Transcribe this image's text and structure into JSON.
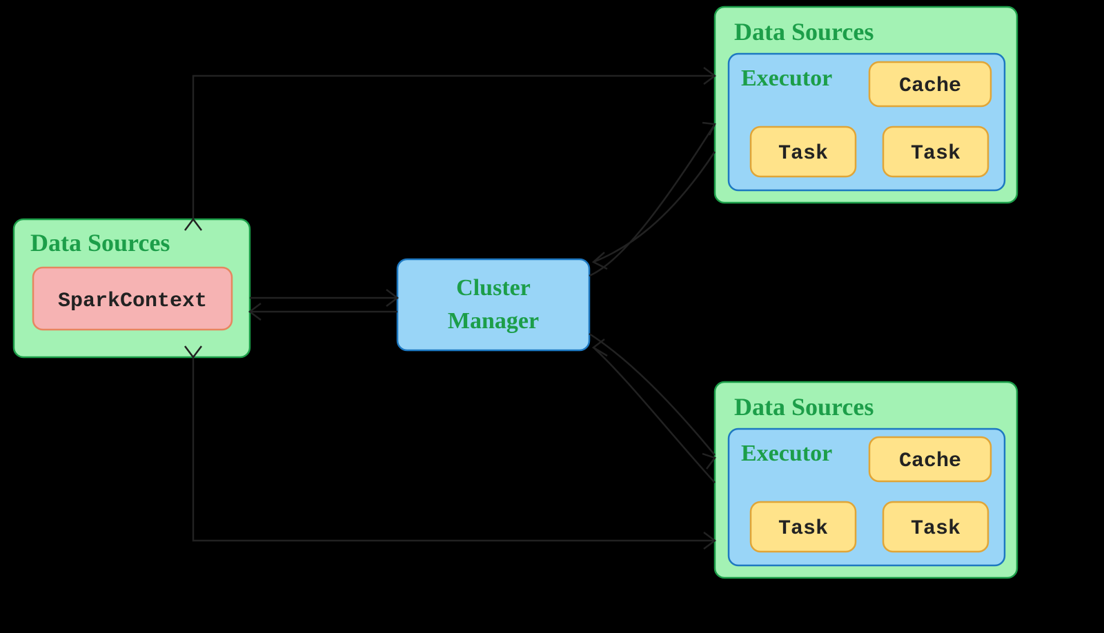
{
  "driver": {
    "title": "Data Sources",
    "sparkContext": "SparkContext"
  },
  "clusterManager": {
    "line1": "Cluster",
    "line2": "Manager"
  },
  "worker1": {
    "title": "Data Sources",
    "executor": "Executor",
    "cache": "Cache",
    "task1": "Task",
    "task2": "Task"
  },
  "worker2": {
    "title": "Data Sources",
    "executor": "Executor",
    "cache": "Cache",
    "task1": "Task",
    "task2": "Task"
  },
  "colors": {
    "green_fill": "#a3f2b4",
    "green_stroke": "#1c9e49",
    "blue_fill": "#99d5f7",
    "blue_stroke": "#1d78c1",
    "pink_fill": "#f6b3b3",
    "yellow_fill": "#ffe38a"
  }
}
